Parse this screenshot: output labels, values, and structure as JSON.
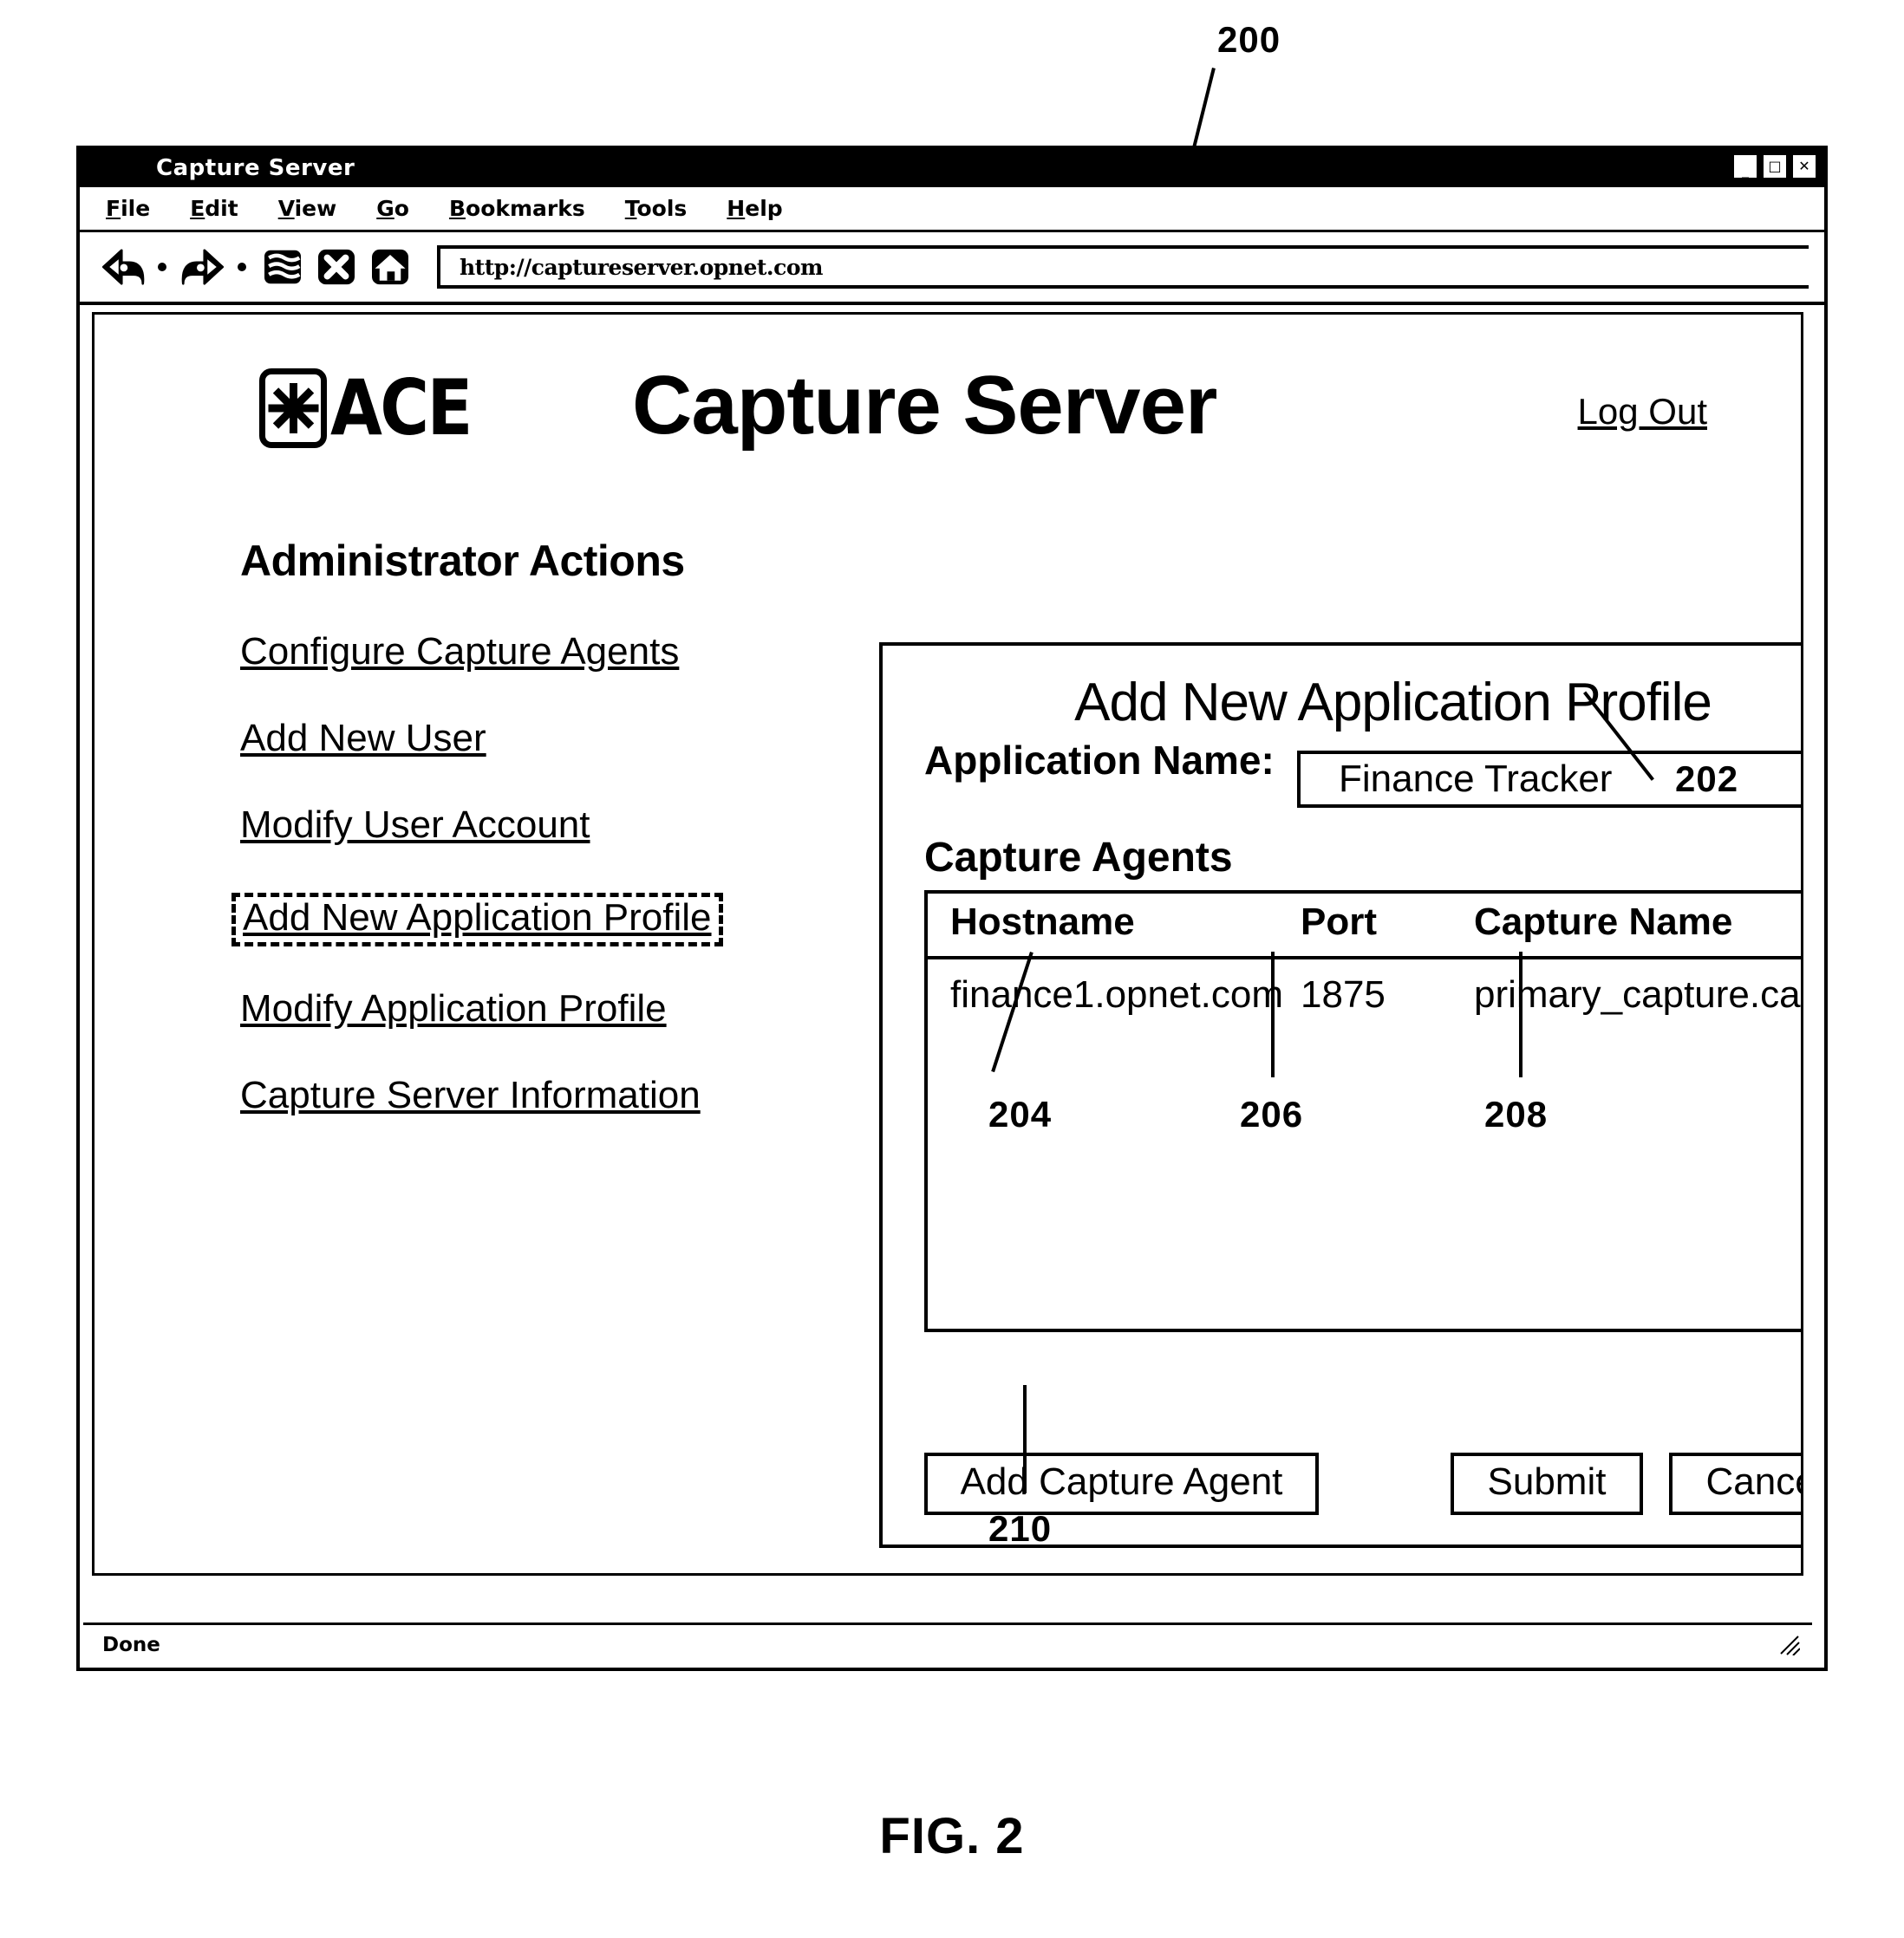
{
  "figure": {
    "caption": "FIG. 2",
    "callouts": [
      {
        "id": "200",
        "label": "200"
      },
      {
        "id": "202",
        "label": "202"
      },
      {
        "id": "204",
        "label": "204"
      },
      {
        "id": "206",
        "label": "206"
      },
      {
        "id": "208",
        "label": "208"
      },
      {
        "id": "210",
        "label": "210"
      }
    ]
  },
  "browser": {
    "title": "Capture Server",
    "window_controls": [
      "_",
      "□",
      "✕"
    ],
    "menu": [
      "File",
      "Edit",
      "View",
      "Go",
      "Bookmarks",
      "Tools",
      "Help"
    ],
    "menu_mnemonics": [
      "F",
      "E",
      "V",
      "G",
      "B",
      "T",
      "H"
    ],
    "toolbar_icons": [
      "back-icon",
      "forward-icon",
      "reload-icon",
      "stop-icon",
      "home-icon"
    ],
    "url": "http://captureserver.opnet.com",
    "status": "Done"
  },
  "app": {
    "logo_text": "ACE",
    "logo_mark": "starburst-icon",
    "title": "Capture Server",
    "logout": "Log Out"
  },
  "sidebar": {
    "heading": "Administrator Actions",
    "items": [
      {
        "label": "Configure Capture Agents",
        "selected": false
      },
      {
        "label": "Add New User",
        "selected": false
      },
      {
        "label": "Modify User Account",
        "selected": false
      },
      {
        "label": "Add New Application Profile",
        "selected": true
      },
      {
        "label": "Modify Application Profile",
        "selected": false
      },
      {
        "label": "Capture Server Information",
        "selected": false
      }
    ]
  },
  "panel": {
    "heading": "Add New Application Profile",
    "app_name_label": "Application Name:",
    "app_name_value": "Finance Tracker",
    "agents_label": "Capture Agents",
    "table": {
      "columns": [
        "Hostname",
        "Port",
        "Capture Name"
      ],
      "rows": [
        {
          "hostname": "finance1.opnet.com",
          "port": "1875",
          "capture_name": "primary_capture.cap"
        }
      ]
    },
    "buttons": {
      "add_agent": "Add Capture Agent",
      "submit": "Submit",
      "cancel": "Cancel"
    }
  }
}
